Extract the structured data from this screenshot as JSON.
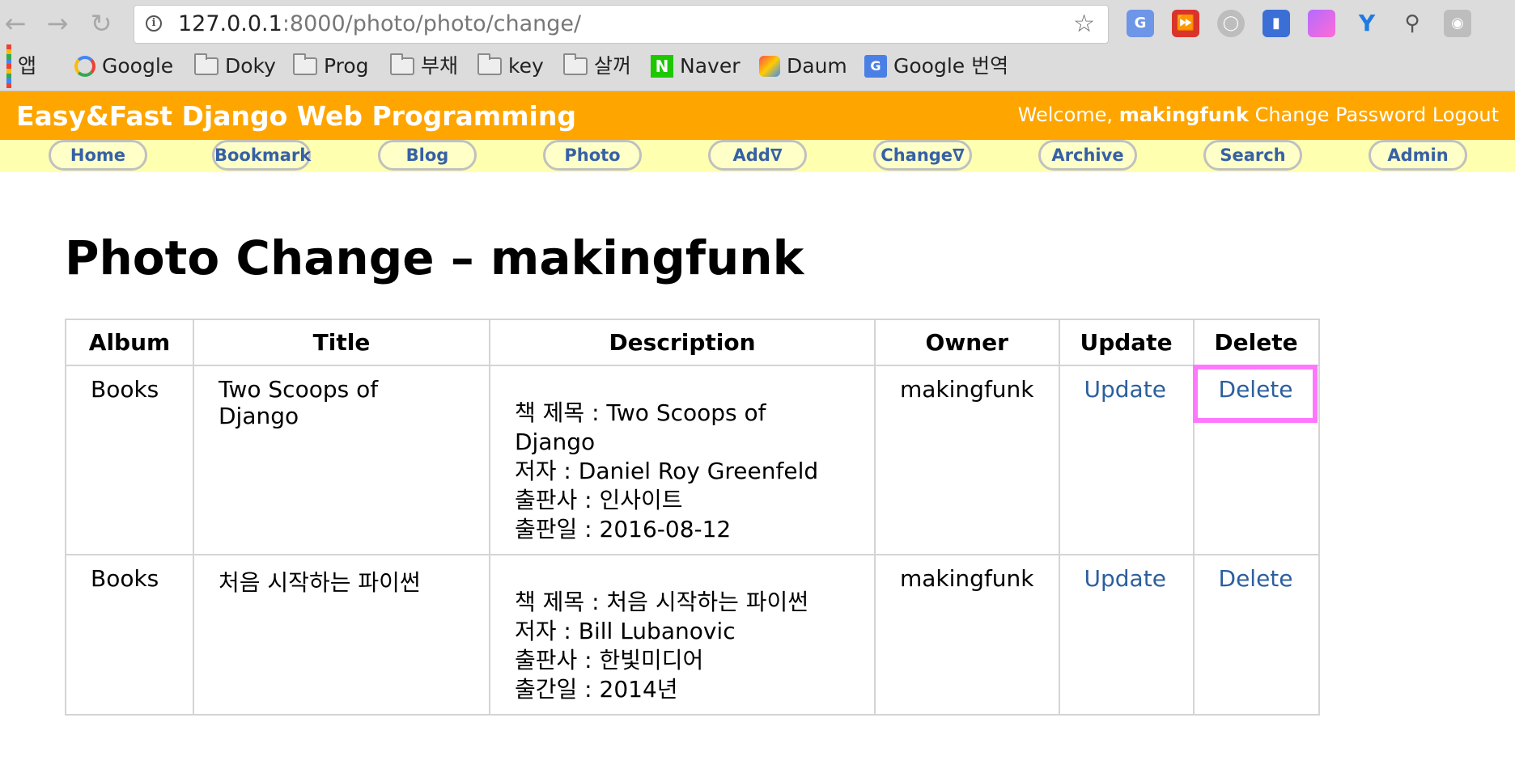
{
  "browser": {
    "url_host": "127.0.0.1",
    "url_rest": ":8000/photo/photo/change/",
    "bookmarks": [
      {
        "label": "앱",
        "icon": "apps-grid-icon"
      },
      {
        "label": "Google",
        "icon": "google-icon"
      },
      {
        "label": "Doky",
        "icon": "folder-icon"
      },
      {
        "label": "Prog",
        "icon": "folder-icon"
      },
      {
        "label": "부채",
        "icon": "folder-icon"
      },
      {
        "label": "key",
        "icon": "folder-icon"
      },
      {
        "label": "살꺼",
        "icon": "folder-icon"
      },
      {
        "label": "Naver",
        "icon": "naver-icon"
      },
      {
        "label": "Daum",
        "icon": "daum-icon"
      },
      {
        "label": "Google 번역",
        "icon": "google-translate-icon"
      }
    ]
  },
  "site": {
    "title": "Easy&Fast Django Web Programming",
    "welcome": "Welcome, ",
    "username": "makingfunk",
    "change_password": "Change Password",
    "logout": "Logout"
  },
  "menu": [
    "Home",
    "Bookmark",
    "Blog",
    "Photo",
    "Add∇",
    "Change∇",
    "Archive",
    "Search",
    "Admin"
  ],
  "page": {
    "heading": "Photo Change – makingfunk"
  },
  "table": {
    "headers": [
      "Album",
      "Title",
      "Description",
      "Owner",
      "Update",
      "Delete"
    ],
    "rows": [
      {
        "album": "Books",
        "title": "Two Scoops of Django",
        "description": [
          "책 제목 : Two Scoops of Django",
          "저자 : Daniel Roy Greenfeld",
          "출판사 : 인사이트",
          "출판일 : 2016-08-12"
        ],
        "owner": "makingfunk",
        "update": "Update",
        "delete": "Delete"
      },
      {
        "album": "Books",
        "title": "처음 시작하는 파이썬",
        "description": [
          "책 제목 : 처음 시작하는 파이썬",
          "저자 : Bill Lubanovic",
          "출판사 : 한빛미디어",
          "출간일 : 2014년"
        ],
        "owner": "makingfunk",
        "update": "Update",
        "delete": "Delete"
      }
    ]
  },
  "colors": {
    "header_bg": "#ffa500",
    "menu_bg": "#ffffb0",
    "link": "#2c5f9e",
    "highlight": "#ff77ff"
  }
}
